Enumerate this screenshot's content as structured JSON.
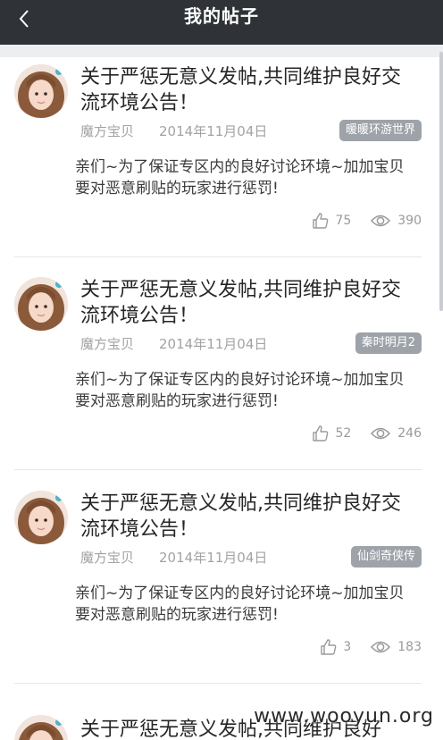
{
  "header": {
    "title": "我的帖子",
    "back_icon": "chevron-left-icon"
  },
  "colors": {
    "header_bg": "#2f3237",
    "badge_bg": "#9ea3a9",
    "divider": "#e4e6e8"
  },
  "posts": [
    {
      "title": "关于严惩无意义发帖,共同维护良好交流环境公告！",
      "author": "魔方宝贝",
      "date": "2014年11月04日",
      "tag": "暖暖环游世界",
      "body": "亲们~为了保证专区内的良好讨论环境~加加宝贝要对恶意刷贴的玩家进行惩罚!",
      "likes": "75",
      "views": "390"
    },
    {
      "title": "关于严惩无意义发帖,共同维护良好交流环境公告！",
      "author": "魔方宝贝",
      "date": "2014年11月04日",
      "tag": "秦时明月2",
      "body": "亲们~为了保证专区内的良好讨论环境~加加宝贝要对恶意刷贴的玩家进行惩罚!",
      "likes": "52",
      "views": "246"
    },
    {
      "title": "关于严惩无意义发帖,共同维护良好交流环境公告！",
      "author": "魔方宝贝",
      "date": "2014年11月04日",
      "tag": "仙剑奇侠传",
      "body": "亲们~为了保证专区内的良好讨论环境~加加宝贝要对恶意刷贴的玩家进行惩罚!",
      "likes": "3",
      "views": "183"
    },
    {
      "title": "关于严惩无意义发帖,共同维护良好"
    }
  ],
  "watermark": "www.wooyun.org"
}
